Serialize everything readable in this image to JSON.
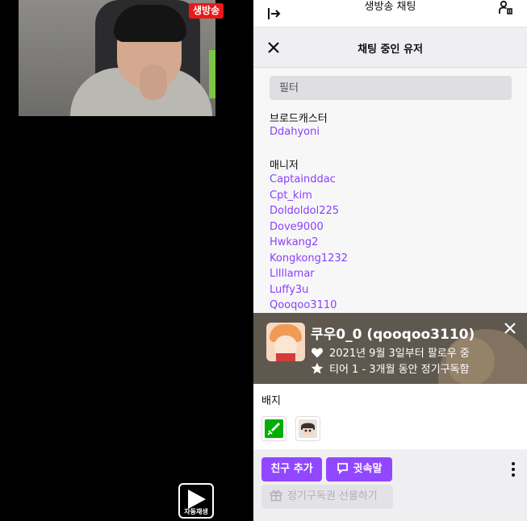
{
  "video": {
    "live_badge": "생방송",
    "autoplay_label": "자동재생"
  },
  "chat_header": {
    "title": "생방송 채팅"
  },
  "users_panel": {
    "title": "채팅 중인 유저",
    "filter_placeholder": "필터",
    "broadcaster_label": "브로드캐스터",
    "broadcaster": "Ddahyoni",
    "manager_label": "매니저",
    "managers": [
      "Captainddac",
      "Cpt_kim",
      "Doldoldol225",
      "Dove9000",
      "Hwkang2",
      "Kongkong1232",
      "Lllllamar",
      "Luffy3u",
      "Qooqoo3110"
    ]
  },
  "viewer_card": {
    "display_name": "쿠우0_0 (qooqoo3110)",
    "follow_text": "2021년 9월 3일부터 팔로우 중",
    "sub_text": "티어 1 - 3개월 동안 정기구독함",
    "badges_label": "배지",
    "add_friend_label": "친구 추가",
    "whisper_label": "귓속말",
    "gift_sub_label": "정기구독권 선물하기"
  },
  "colors": {
    "accent": "#9147ff",
    "username": "#8a3ffc",
    "live_red": "#e91916"
  }
}
